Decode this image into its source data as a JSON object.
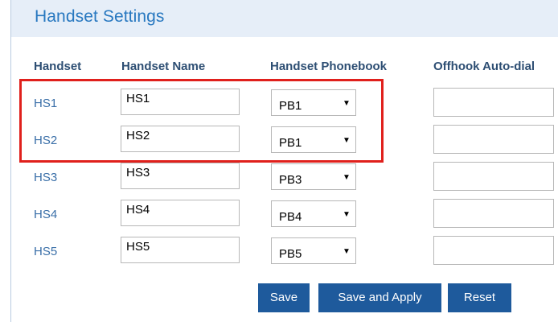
{
  "title": "Handset Settings",
  "columns": {
    "handset": "Handset",
    "name": "Handset Name",
    "phonebook": "Handset Phonebook",
    "autodial": "Offhook Auto-dial"
  },
  "rows": [
    {
      "handset": "HS1",
      "name": "HS1",
      "phonebook": "PB1",
      "autodial": ""
    },
    {
      "handset": "HS2",
      "name": "HS2",
      "phonebook": "PB1",
      "autodial": ""
    },
    {
      "handset": "HS3",
      "name": "HS3",
      "phonebook": "PB3",
      "autodial": ""
    },
    {
      "handset": "HS4",
      "name": "HS4",
      "phonebook": "PB4",
      "autodial": ""
    },
    {
      "handset": "HS5",
      "name": "HS5",
      "phonebook": "PB5",
      "autodial": ""
    }
  ],
  "buttons": {
    "save": "Save",
    "save_apply": "Save and Apply",
    "reset": "Reset"
  },
  "dropdown_arrow": "▼",
  "colors": {
    "accent": "#1e5a9c",
    "title": "#2878c0",
    "highlight": "#e0201c"
  }
}
